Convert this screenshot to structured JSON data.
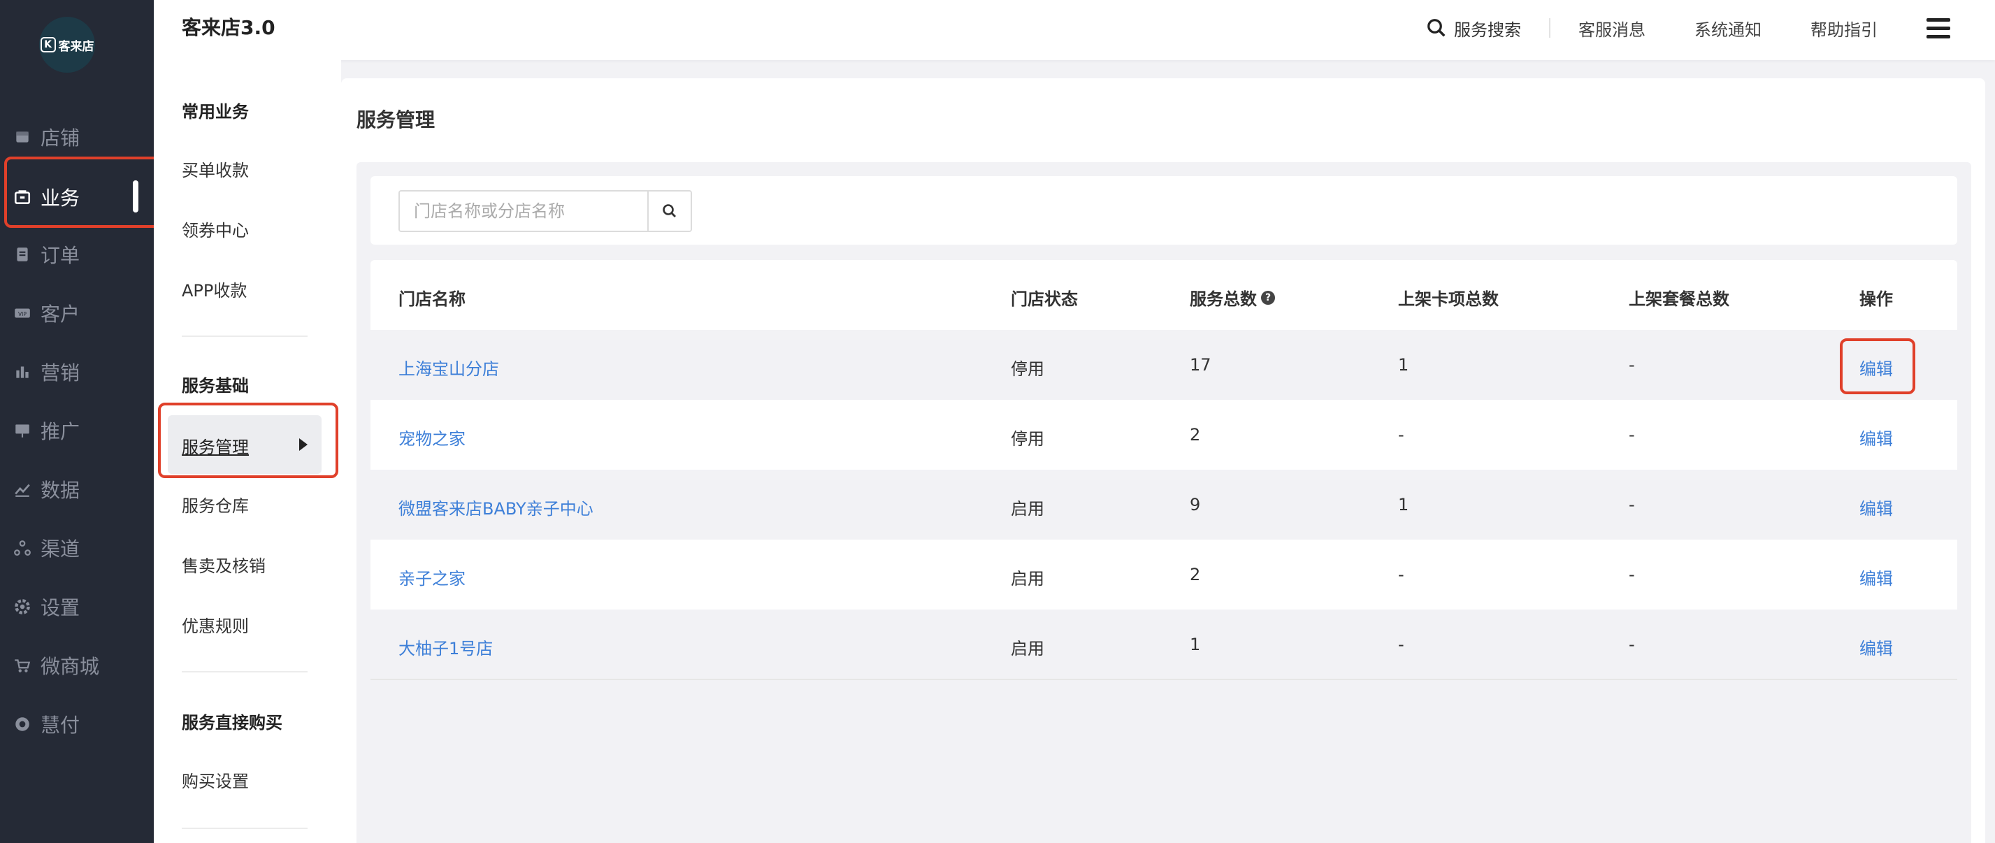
{
  "app": {
    "title": "客来店3.0",
    "logo_text": "客来店",
    "logo_mark": "K"
  },
  "sidebar": {
    "items": [
      {
        "label": "店铺",
        "icon": "store-icon"
      },
      {
        "label": "业务",
        "icon": "briefcase-icon",
        "active": true
      },
      {
        "label": "订单",
        "icon": "order-list-icon"
      },
      {
        "label": "客户",
        "icon": "vip-icon"
      },
      {
        "label": "营销",
        "icon": "bar-chart-icon"
      },
      {
        "label": "推广",
        "icon": "billboard-icon"
      },
      {
        "label": "数据",
        "icon": "line-chart-icon"
      },
      {
        "label": "渠道",
        "icon": "channel-icon"
      },
      {
        "label": "设置",
        "icon": "gear-icon"
      },
      {
        "label": "微商城",
        "icon": "cart-icon"
      },
      {
        "label": "慧付",
        "icon": "pay-icon"
      }
    ]
  },
  "header": {
    "search_label": "服务搜索",
    "nav": [
      "客服消息",
      "系统通知",
      "帮助指引"
    ]
  },
  "subnav": {
    "group1": "常用业务",
    "group1_items": [
      "买单收款",
      "领券中心",
      "APP收款"
    ],
    "group2": "服务基础",
    "active_item": "服务管理",
    "group2_items": [
      "服务仓库",
      "售卖及核销",
      "优惠规则"
    ],
    "group3": "服务直接购买",
    "group3_items": [
      "购买设置"
    ]
  },
  "main": {
    "title": "服务管理",
    "search": {
      "placeholder": "门店名称或分店名称",
      "value": ""
    },
    "table": {
      "columns": [
        "门店名称",
        "门店状态",
        "服务总数",
        "上架卡项总数",
        "上架套餐总数",
        "操作"
      ],
      "rows": [
        {
          "name": "上海宝山分店",
          "status": "停用",
          "services": "17",
          "cards": "1",
          "packages": "-",
          "action": "编辑"
        },
        {
          "name": "宠物之家",
          "status": "停用",
          "services": "2",
          "cards": "-",
          "packages": "-",
          "action": "编辑"
        },
        {
          "name": "微盟客来店BABY亲子中心",
          "status": "启用",
          "services": "9",
          "cards": "1",
          "packages": "-",
          "action": "编辑"
        },
        {
          "name": "亲子之家",
          "status": "启用",
          "services": "2",
          "cards": "-",
          "packages": "-",
          "action": "编辑"
        },
        {
          "name": "大柚子1号店",
          "status": "启用",
          "services": "1",
          "cards": "-",
          "packages": "-",
          "action": "编辑"
        }
      ]
    }
  },
  "colors": {
    "sidebar_bg": "#252a36",
    "link": "#3d7fd8",
    "highlight": "#e0402a"
  }
}
